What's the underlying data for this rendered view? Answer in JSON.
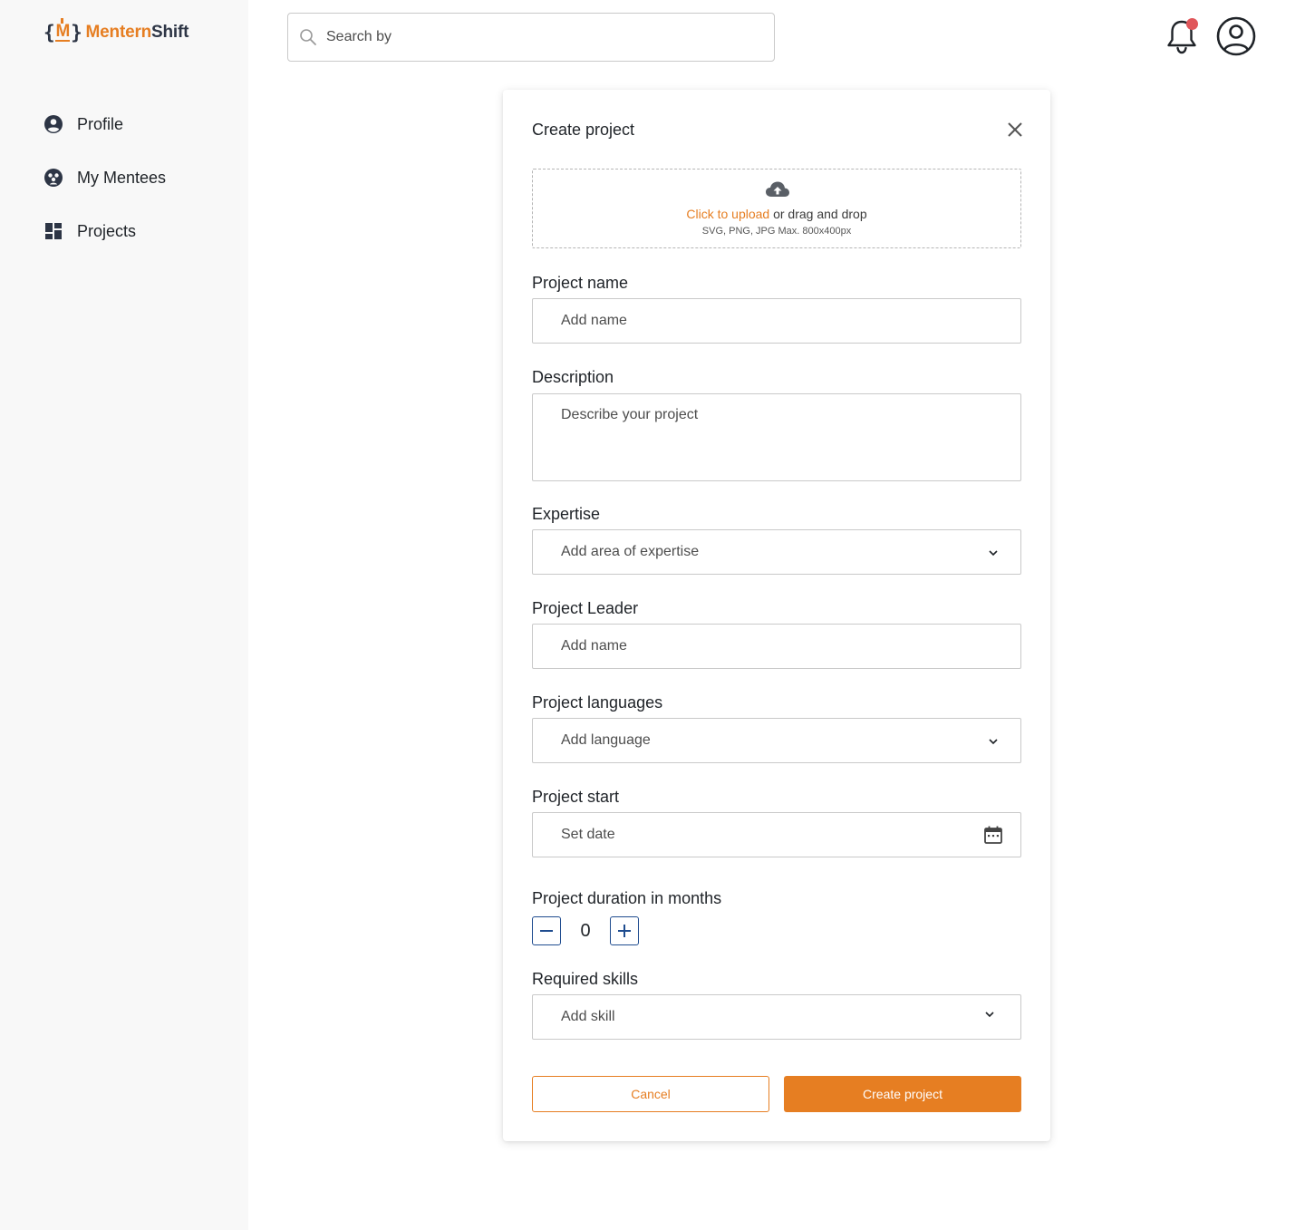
{
  "brand": {
    "bracket_open": "{",
    "mark": "M",
    "bracket_close": "}",
    "name_a": "Mentern",
    "name_b": "Shift",
    "accent": "#e67e22",
    "dark": "#2d3545"
  },
  "sidebar": {
    "items": [
      {
        "label": "Profile",
        "icon": "user-circle-icon"
      },
      {
        "label": "My Mentees",
        "icon": "group-icon"
      },
      {
        "label": "Projects",
        "icon": "dashboard-icon"
      }
    ]
  },
  "header": {
    "search_placeholder": "Search by",
    "notification_dot_color": "#e0565a"
  },
  "modal": {
    "title": "Create project",
    "upload": {
      "link": "Click to upload",
      "rest": " or drag and drop",
      "hint": "SVG, PNG, JPG Max. 800x400px"
    },
    "fields": {
      "project_name": {
        "label": "Project name",
        "placeholder": "Add name"
      },
      "description": {
        "label": "Description",
        "placeholder": "Describe your project"
      },
      "expertise": {
        "label": "Expertise",
        "placeholder": "Add area of expertise"
      },
      "leader": {
        "label": "Project Leader",
        "placeholder": "Add name"
      },
      "languages": {
        "label": "Project languages",
        "placeholder": "Add language"
      },
      "start": {
        "label": "Project start",
        "placeholder": "Set date"
      },
      "duration": {
        "label": "Project duration in months",
        "value": "0"
      },
      "skills": {
        "label": "Required skills",
        "placeholder": "Add skill"
      }
    },
    "cancel_label": "Cancel",
    "create_label": "Create project"
  }
}
